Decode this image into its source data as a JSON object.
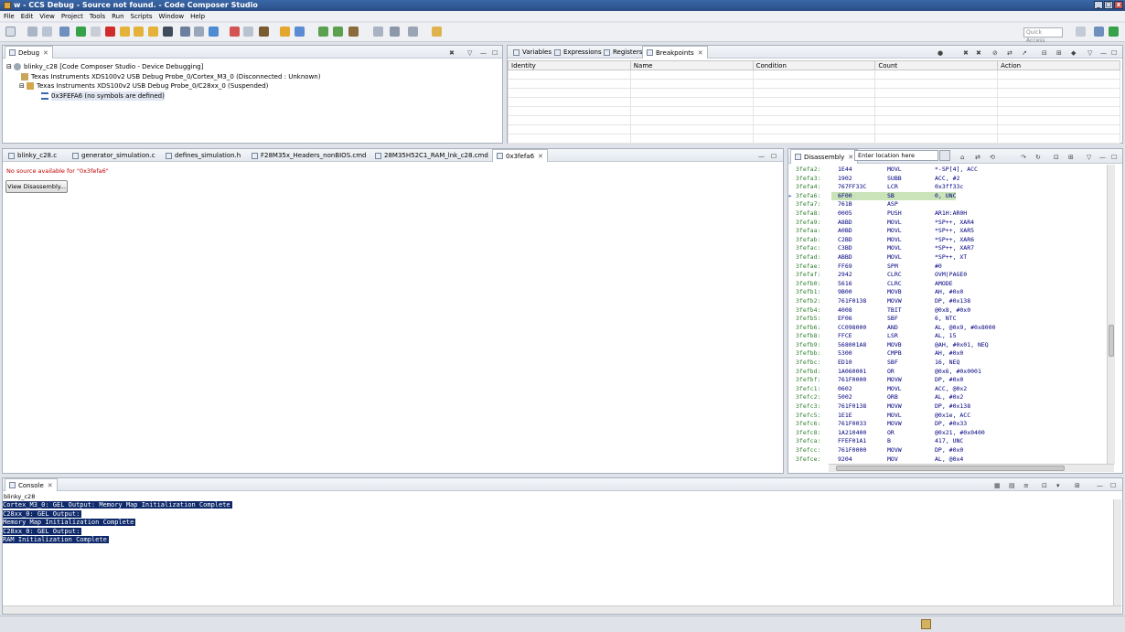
{
  "window": {
    "title": "w - CCS Debug - Source not found. - Code Composer Studio",
    "minimize_glyph": "_",
    "maximize_glyph": "□",
    "close_glyph": "x"
  },
  "menu": [
    "File",
    "Edit",
    "View",
    "Project",
    "Tools",
    "Run",
    "Scripts",
    "Window",
    "Help"
  ],
  "toolbar": {
    "quick_access_placeholder": "Quick Access"
  },
  "debug_view": {
    "tab": "Debug",
    "tree": [
      "blinky_c28 [Code Composer Studio - Device Debugging]",
      "Texas Instruments XDS100v2 USB Debug Probe_0/Cortex_M3_0 (Disconnected : Unknown)",
      "Texas Instruments XDS100v2 USB Debug Probe_0/C28xx_0 (Suspended)",
      "0x3FEFA6  (no symbols are defined)"
    ]
  },
  "breakpoints_view": {
    "tabs": [
      "Variables",
      "Expressions",
      "Registers",
      "Breakpoints"
    ],
    "columns": [
      "Identity",
      "Name",
      "Condition",
      "Count",
      "Action"
    ]
  },
  "editor": {
    "tabs": [
      "blinky_c28.c",
      "generator_simulation.c",
      "defines_simulation.h",
      "F28M35x_Headers_nonBIOS.cmd",
      "28M35H52C1_RAM_lnk_c28.cmd",
      "0x3fefa6"
    ],
    "no_source_msg": "No source available for \"0x3fefa6\"",
    "view_disassembly_button": "View Disassembly..."
  },
  "disassembly": {
    "tab": "Disassembly",
    "location_placeholder": "Enter location here",
    "current_row": 2,
    "rows": [
      {
        "addr": "3fefa2:",
        "op": "1E44",
        "mn": "MOVL",
        "args": "*-SP[4], ACC"
      },
      {
        "addr": "3fefa3:",
        "op": "1902",
        "mn": "SUBB",
        "args": "ACC, #2"
      },
      {
        "addr": "3fefa4:",
        "op": "767FF33C",
        "mn": "LCR",
        "args": "0x3ff33c"
      },
      {
        "addr": "3fefa6:",
        "op": "6F00",
        "mn": "SB",
        "args": "0, UNC"
      },
      {
        "addr": "3fefa7:",
        "op": "761B",
        "mn": "ASP",
        "args": ""
      },
      {
        "addr": "3fefa8:",
        "op": "0005",
        "mn": "PUSH",
        "args": "AR1H:AR0H"
      },
      {
        "addr": "3fefa9:",
        "op": "A8BD",
        "mn": "MOVL",
        "args": "*SP++, XAR4"
      },
      {
        "addr": "3fefaa:",
        "op": "A0BD",
        "mn": "MOVL",
        "args": "*SP++, XAR5"
      },
      {
        "addr": "3fefab:",
        "op": "C2BD",
        "mn": "MOVL",
        "args": "*SP++, XAR6"
      },
      {
        "addr": "3fefac:",
        "op": "C3BD",
        "mn": "MOVL",
        "args": "*SP++, XAR7"
      },
      {
        "addr": "3fefad:",
        "op": "ABBD",
        "mn": "MOVL",
        "args": "*SP++, XT"
      },
      {
        "addr": "3fefae:",
        "op": "FF69",
        "mn": "SPM",
        "args": "#0"
      },
      {
        "addr": "3fefaf:",
        "op": "2942",
        "mn": "CLRC",
        "args": "OVM|PAGE0"
      },
      {
        "addr": "3fefb0:",
        "op": "5616",
        "mn": "CLRC",
        "args": "AMODE"
      },
      {
        "addr": "3fefb1:",
        "op": "9B00",
        "mn": "MOVB",
        "args": "AH, #0x0"
      },
      {
        "addr": "3fefb2:",
        "op": "761F0138",
        "mn": "MOVW",
        "args": "DP, #0x138"
      },
      {
        "addr": "3fefb4:",
        "op": "4008",
        "mn": "TBIT",
        "args": "@0x8, #0x0"
      },
      {
        "addr": "3fefb5:",
        "op": "EF06",
        "mn": "SBF",
        "args": "6, NTC"
      },
      {
        "addr": "3fefb6:",
        "op": "CC098000",
        "mn": "AND",
        "args": "AL, @0x9, #0x8000"
      },
      {
        "addr": "3fefb8:",
        "op": "FFCE",
        "mn": "LSR",
        "args": "AL, 15"
      },
      {
        "addr": "3fefb9:",
        "op": "568001A8",
        "mn": "MOVB",
        "args": "@AH, #0x01, NEQ"
      },
      {
        "addr": "3fefbb:",
        "op": "5300",
        "mn": "CMPB",
        "args": "AH, #0x0"
      },
      {
        "addr": "3fefbc:",
        "op": "ED10",
        "mn": "SBF",
        "args": "16, NEQ"
      },
      {
        "addr": "3fefbd:",
        "op": "1A060001",
        "mn": "OR",
        "args": "@0x6, #0x0001"
      },
      {
        "addr": "3fefbf:",
        "op": "761F0000",
        "mn": "MOVW",
        "args": "DP, #0x0"
      },
      {
        "addr": "3fefc1:",
        "op": "0602",
        "mn": "MOVL",
        "args": "ACC, @0x2"
      },
      {
        "addr": "3fefc2:",
        "op": "5002",
        "mn": "ORB",
        "args": "AL, #0x2"
      },
      {
        "addr": "3fefc3:",
        "op": "761F0138",
        "mn": "MOVW",
        "args": "DP, #0x138"
      },
      {
        "addr": "3fefc5:",
        "op": "1E1E",
        "mn": "MOVL",
        "args": "@0x1e, ACC"
      },
      {
        "addr": "3fefc6:",
        "op": "761F0033",
        "mn": "MOVW",
        "args": "DP, #0x33"
      },
      {
        "addr": "3fefc8:",
        "op": "1A210400",
        "mn": "OR",
        "args": "@0x21, #0x0400"
      },
      {
        "addr": "3fefca:",
        "op": "FFEF01A1",
        "mn": "B",
        "args": "417, UNC"
      },
      {
        "addr": "3fefcc:",
        "op": "761F0000",
        "mn": "MOVW",
        "args": "DP, #0x0"
      },
      {
        "addr": "3fefce:",
        "op": "9204",
        "mn": "MOV",
        "args": "AL, @0x4"
      }
    ]
  },
  "console": {
    "tab": "Console",
    "subtitle": "blinky_c28",
    "lines": [
      "Cortex_M3_0: GEL Output: Memory Map Initialization Complete",
      "C28xx_0: GEL Output: ",
      "Memory Map Initialization Complete",
      "C28xx_0: GEL Output: ",
      "RAM Initialization Complete"
    ]
  }
}
